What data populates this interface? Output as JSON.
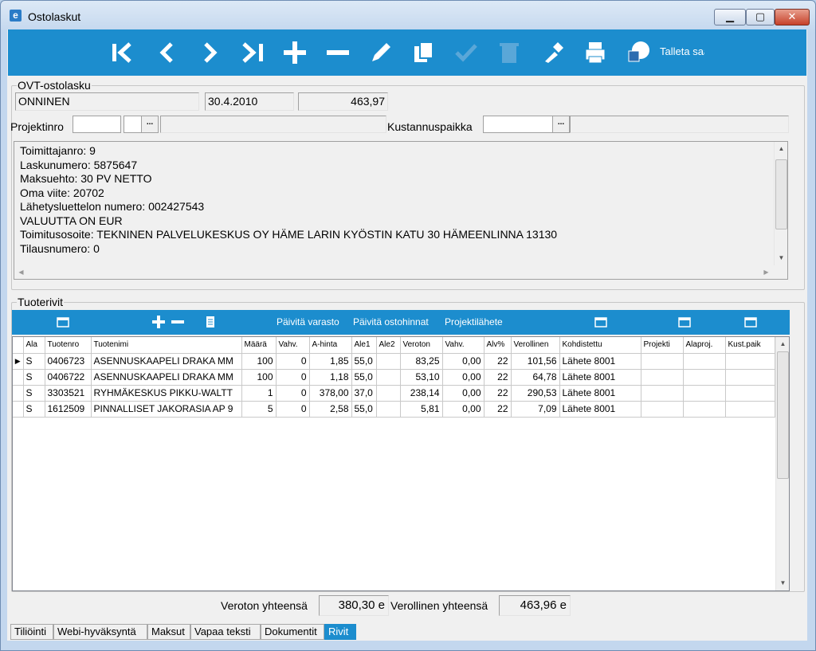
{
  "window": {
    "title": "Ostolaskut",
    "app_icon_letter": "e",
    "minimize": "▁",
    "maximize": "▢",
    "close": "✕"
  },
  "toolbar": {
    "save_text": "Talleta saa"
  },
  "header": {
    "group_title": "OVT-ostolasku",
    "supplier": "ONNINEN",
    "date": "30.4.2010",
    "amount": "463,97",
    "project_label": "Projektinro",
    "cost_center_label": "Kustannuspaikka",
    "ellipsis": "..."
  },
  "memo": {
    "lines": [
      "Toimittajanro: 9",
      "Laskunumero: 5875647",
      "Maksuehto: 30 PV NETTO",
      "Oma viite: 20702",
      "Lähetysluettelon numero: 002427543",
      "VALUUTTA ON EUR",
      "Toimitusosoite: TEKNINEN PALVELUKESKUS OY HÄME LARIN KYÖSTIN KATU 30 HÄMEENLINNA 13130",
      "Tilausnumero: 0"
    ]
  },
  "rows_section": {
    "group_title": "Tuoterivit",
    "update_stock": "Päivitä varasto",
    "update_prices": "Päivitä ostohinnat",
    "project_delivery": "Projektilähete"
  },
  "grid": {
    "columns": [
      "Ala",
      "Tuotenro",
      "Tuotenimi",
      "Määrä",
      "Vahv.",
      "A-hinta",
      "Ale1",
      "Ale2",
      "Veroton",
      "Vahv.",
      "Alv%",
      "Verollinen",
      "Kohdistettu",
      "Projekti",
      "Alaproj.",
      "Kust.paik"
    ],
    "rows": [
      [
        "S",
        "0406723",
        "ASENNUSKAAPELI DRAKA MM",
        "100",
        "0",
        "1,85",
        "55,0",
        "",
        "83,25",
        "0,00",
        "22",
        "101,56",
        "Lähete 8001",
        "",
        "",
        ""
      ],
      [
        "S",
        "0406722",
        "ASENNUSKAAPELI DRAKA MM",
        "100",
        "0",
        "1,18",
        "55,0",
        "",
        "53,10",
        "0,00",
        "22",
        "64,78",
        "Lähete 8001",
        "",
        "",
        ""
      ],
      [
        "S",
        "3303521",
        "RYHMÄKESKUS PIKKU-WALTT",
        "1",
        "0",
        "378,00",
        "37,0",
        "",
        "238,14",
        "0,00",
        "22",
        "290,53",
        "Lähete 8001",
        "",
        "",
        ""
      ],
      [
        "S",
        "1612509",
        "PINNALLISET JAKORASIA AP 9",
        "5",
        "0",
        "2,58",
        "55,0",
        "",
        "5,81",
        "0,00",
        "22",
        "7,09",
        "Lähete 8001",
        "",
        "",
        ""
      ]
    ]
  },
  "totals": {
    "net_label": "Veroton yhteensä",
    "net_value": "380,30 e",
    "gross_label": "Verollinen yhteensä",
    "gross_value": "463,96 e"
  },
  "tabs": [
    "Tiliöinti",
    "Webi-hyväksyntä",
    "Maksut",
    "Vapaa teksti",
    "Dokumentit",
    "Rivit"
  ],
  "colors": {
    "accent": "#1c8dce",
    "disabled_icon": "#5aa7d8"
  }
}
